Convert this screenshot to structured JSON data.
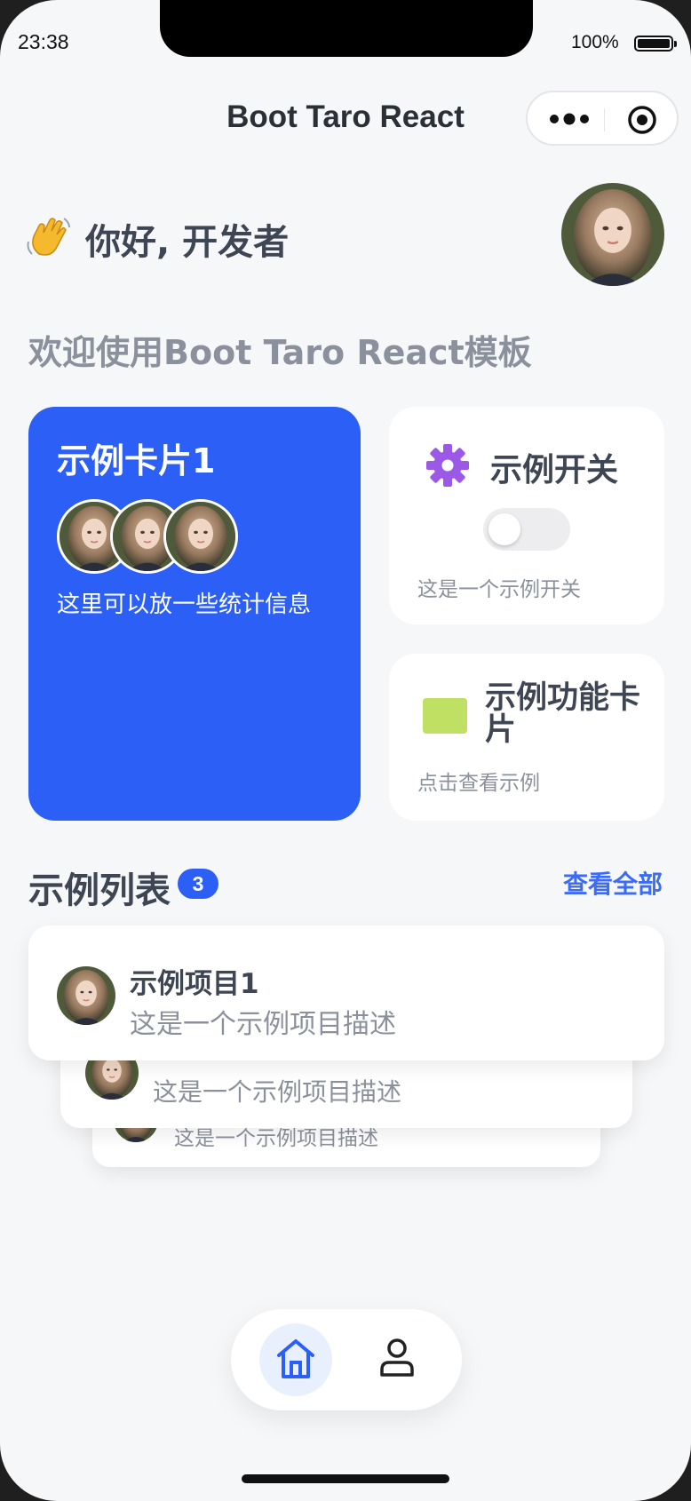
{
  "status_bar": {
    "time": "23:38",
    "battery": "100%"
  },
  "nav": {
    "title": "Boot Taro React"
  },
  "greeting": {
    "text": "你好, 开发者"
  },
  "welcome": {
    "text": "欢迎使用Boot Taro React模板"
  },
  "card_primary": {
    "title": "示例卡片1",
    "desc": "这里可以放一些统计信息"
  },
  "card_switch": {
    "title": "示例开关",
    "desc": "这是一个示例开关",
    "enabled": false
  },
  "card_feature": {
    "title": "示例功能卡片",
    "desc": "点击查看示例"
  },
  "list": {
    "title": "示例列表",
    "count": "3",
    "view_all": "查看全部",
    "items": [
      {
        "title": "示例项目1",
        "desc": "这是一个示例项目描述"
      },
      {
        "title": "",
        "desc": "这是一个示例项目描述"
      },
      {
        "title": "",
        "desc": "这是一个示例项目描述"
      }
    ]
  },
  "tabbar": {
    "active": "home",
    "tabs": [
      "home",
      "user"
    ]
  },
  "colors": {
    "primary": "#2c5ff6",
    "accent_purple": "#9b59e6",
    "accent_green": "#bfe062"
  }
}
